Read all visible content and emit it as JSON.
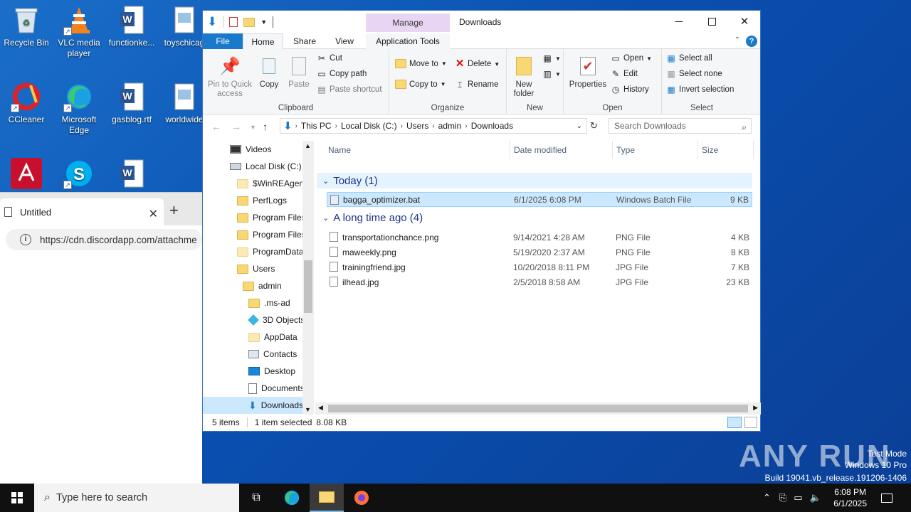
{
  "desktop": {
    "icons": [
      {
        "label": "Recycle Bin"
      },
      {
        "label": "VLC media player"
      },
      {
        "label": "functionke..."
      },
      {
        "label": "toyschicag"
      },
      {
        "label": "CCleaner"
      },
      {
        "label": "Microsoft Edge"
      },
      {
        "label": "gasblog.rtf"
      },
      {
        "label": "worldwide"
      }
    ]
  },
  "browser": {
    "tab_title": "Untitled",
    "url": "https://cdn.discordapp.com/attachme"
  },
  "explorer": {
    "title": "Downloads",
    "manage_label": "Manage",
    "tabs": [
      "File",
      "Home",
      "Share",
      "View",
      "Application Tools"
    ],
    "ribbon": {
      "clipboard": {
        "group": "Clipboard",
        "pin": "Pin to Quick access",
        "copy": "Copy",
        "paste": "Paste",
        "cut": "Cut",
        "copy_path": "Copy path",
        "paste_shortcut": "Paste shortcut"
      },
      "organize": {
        "group": "Organize",
        "move_to": "Move to",
        "copy_to": "Copy to",
        "delete": "Delete",
        "rename": "Rename"
      },
      "new": {
        "group": "New",
        "new_folder": "New folder"
      },
      "open": {
        "group": "Open",
        "properties": "Properties",
        "open": "Open",
        "edit": "Edit",
        "history": "History"
      },
      "select": {
        "group": "Select",
        "select_all": "Select all",
        "select_none": "Select none",
        "invert": "Invert selection"
      }
    },
    "breadcrumb": [
      "This PC",
      "Local Disk (C:)",
      "Users",
      "admin",
      "Downloads"
    ],
    "search_placeholder": "Search Downloads",
    "nav_tree": [
      {
        "label": "Videos"
      },
      {
        "label": "Local Disk (C:)"
      },
      {
        "label": "$WinREAgent"
      },
      {
        "label": "PerfLogs"
      },
      {
        "label": "Program Files"
      },
      {
        "label": "Program Files"
      },
      {
        "label": "ProgramData"
      },
      {
        "label": "Users"
      },
      {
        "label": "admin"
      },
      {
        "label": ".ms-ad"
      },
      {
        "label": "3D Objects"
      },
      {
        "label": "AppData"
      },
      {
        "label": "Contacts"
      },
      {
        "label": "Desktop"
      },
      {
        "label": "Documents"
      },
      {
        "label": "Downloads"
      }
    ],
    "columns": [
      "Name",
      "Date modified",
      "Type",
      "Size"
    ],
    "groups": [
      {
        "header": "Today (1)",
        "files": [
          {
            "name": "bagga_optimizer.bat",
            "date": "6/1/2025 6:08 PM",
            "type": "Windows Batch File",
            "size": "9 KB"
          }
        ]
      },
      {
        "header": "A long time ago (4)",
        "files": [
          {
            "name": "transportationchance.png",
            "date": "9/14/2021 4:28 AM",
            "type": "PNG File",
            "size": "4 KB"
          },
          {
            "name": "maweekly.png",
            "date": "5/19/2020 2:37 AM",
            "type": "PNG File",
            "size": "8 KB"
          },
          {
            "name": "trainingfriend.jpg",
            "date": "10/20/2018 8:11 PM",
            "type": "JPG File",
            "size": "7 KB"
          },
          {
            "name": "ilhead.jpg",
            "date": "2/5/2018 8:58 AM",
            "type": "JPG File",
            "size": "23 KB"
          }
        ]
      }
    ],
    "status": {
      "count": "5 items",
      "selected": "1 item selected",
      "size": "8.08 KB"
    }
  },
  "watermark": {
    "brand": "ANY RUN",
    "line1": "Test Mode",
    "line2": "Windows 10 Pro",
    "line3": "Build 19041.vb_release.191206-1406"
  },
  "taskbar": {
    "search_placeholder": "Type here to search",
    "time": "6:08 PM",
    "date": "6/1/2025"
  },
  "colors": {
    "accent": "#1979ca",
    "selection": "#cce8ff",
    "desktop": "#0b4fb0",
    "manage_tab": "#e8d5f3"
  }
}
